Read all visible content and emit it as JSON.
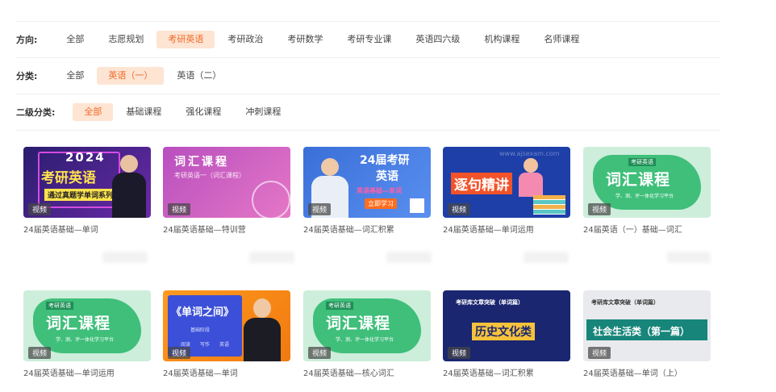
{
  "filters": {
    "direction": {
      "label": "方向:",
      "options": [
        "全部",
        "志愿规划",
        "考研英语",
        "考研政治",
        "考研数学",
        "考研专业课",
        "英语四六级",
        "机构课程",
        "名师课程"
      ]
    },
    "category": {
      "label": "分类:",
      "options": [
        "全部",
        "英语（一）",
        "英语（二）"
      ]
    },
    "subcategory": {
      "label": "二级分类:",
      "options": [
        "全部",
        "基础课程",
        "强化课程",
        "冲刺课程"
      ]
    }
  },
  "badge_label": "视频",
  "cards": [
    {
      "title": "24届英语基础—单词",
      "thumb_text": [
        "2024",
        "考研英语",
        "通过真题学单词系列课"
      ]
    },
    {
      "title": "24届英语基础—特训营",
      "thumb_text": [
        "词汇课程",
        "考研英语一（词汇课程）"
      ]
    },
    {
      "title": "24届英语基础—词汇积累",
      "thumb_text": [
        "24届考研",
        "英语",
        "英语基础—单词",
        "立即学习"
      ]
    },
    {
      "title": "24届英语基础—单词运用",
      "thumb_text": [
        "逐句精讲",
        "www.ajsexam.com"
      ]
    },
    {
      "title": "24届英语（一）基础—词汇",
      "thumb_text": [
        "词汇课程",
        "考研英语",
        "学、测、评一体化学习平台"
      ]
    },
    {
      "title": "24届英语基础—单词运用",
      "thumb_text": [
        "词汇课程",
        "考研英语",
        "学、测、评一体化学习平台"
      ]
    },
    {
      "title": "24届英语基础—单词",
      "thumb_text": [
        "《单词之间》",
        "基础阶段",
        "阅读",
        "写作",
        "英语"
      ]
    },
    {
      "title": "24届英语基础—核心词汇",
      "thumb_text": [
        "词汇课程",
        "考研英语",
        "学、测、评一体化学习平台"
      ]
    },
    {
      "title": "24届英语基础—词汇积累",
      "thumb_text": [
        "考研库文章突破（单词篇）",
        "历史文化类"
      ]
    },
    {
      "title": "24届英语基础—单词（上）",
      "thumb_text": [
        "考研库文章突破（单词篇）",
        "社会生活类（第一篇）"
      ]
    }
  ]
}
